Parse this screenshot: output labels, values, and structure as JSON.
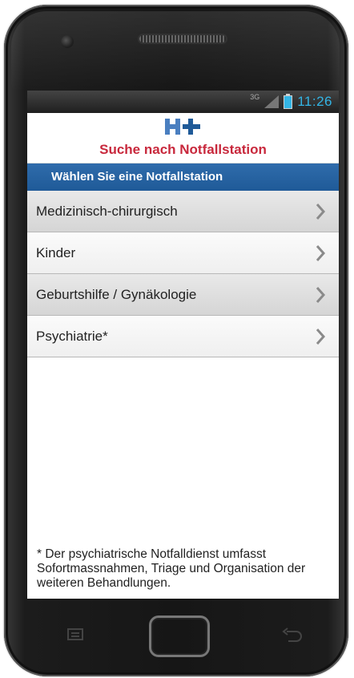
{
  "status_bar": {
    "network": "3G",
    "time": "11:26",
    "icons": [
      "signal-icon",
      "battery-icon"
    ]
  },
  "header": {
    "logo": "H+",
    "title": "Suche nach Notfallstation"
  },
  "section": {
    "title": "Wählen Sie eine Notfallstation"
  },
  "list": {
    "items": [
      {
        "label": "Medizinisch-chirurgisch"
      },
      {
        "label": "Kinder"
      },
      {
        "label": "Geburtshilfe / Gynäkologie"
      },
      {
        "label": "Psychiatrie*"
      }
    ]
  },
  "footnote": "* Der psychiatrische Notfalldienst umfasst Sofortmassnahmen, Triage und Organisation der weiteren Behandlungen.",
  "colors": {
    "title_red": "#c8283c",
    "section_blue": "#1f5a98",
    "logo_blue": "#4a7fc0",
    "status_blue": "#33b5e5"
  }
}
